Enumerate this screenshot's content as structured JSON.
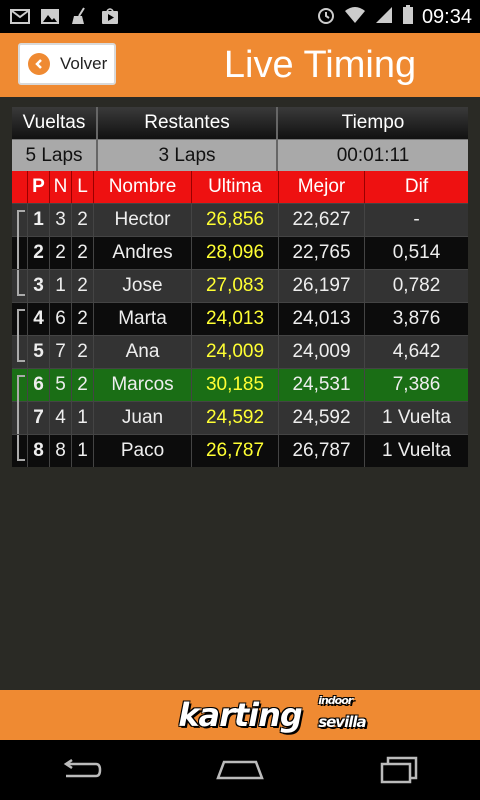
{
  "status": {
    "time": "09:34"
  },
  "header": {
    "back_label": "Volver",
    "title": "Live Timing"
  },
  "summary": {
    "headers": [
      "Vueltas",
      "Restantes",
      "Tiempo"
    ],
    "values": [
      "5 Laps",
      "3 Laps",
      "00:01:11"
    ]
  },
  "columns": {
    "p": "P",
    "n": "N",
    "l": "L",
    "name": "Nombre",
    "last": "Ultima",
    "best": "Mejor",
    "dif": "Dif"
  },
  "rows": [
    {
      "p": "1",
      "n": "3",
      "l": "2",
      "name": "Hector",
      "last": "26,856",
      "best": "22,627",
      "dif": "-"
    },
    {
      "p": "2",
      "n": "2",
      "l": "2",
      "name": "Andres",
      "last": "28,096",
      "best": "22,765",
      "dif": "0,514"
    },
    {
      "p": "3",
      "n": "1",
      "l": "2",
      "name": "Jose",
      "last": "27,083",
      "best": "26,197",
      "dif": "0,782"
    },
    {
      "p": "4",
      "n": "6",
      "l": "2",
      "name": "Marta",
      "last": "24,013",
      "best": "24,013",
      "dif": "3,876"
    },
    {
      "p": "5",
      "n": "7",
      "l": "2",
      "name": "Ana",
      "last": "24,009",
      "best": "24,009",
      "dif": "4,642"
    },
    {
      "p": "6",
      "n": "5",
      "l": "2",
      "name": "Marcos",
      "last": "30,185",
      "best": "24,531",
      "dif": "7,386"
    },
    {
      "p": "7",
      "n": "4",
      "l": "1",
      "name": "Juan",
      "last": "24,592",
      "best": "24,592",
      "dif": "1 Vuelta"
    },
    {
      "p": "8",
      "n": "8",
      "l": "1",
      "name": "Paco",
      "last": "26,787",
      "best": "26,787",
      "dif": "1 Vuelta"
    }
  ],
  "footer": {
    "logo": "karting",
    "logo_sub": "indoor",
    "logo_sub2": "sevilla"
  },
  "colors": {
    "accent": "#ef8a32",
    "header_red": "#ee1111",
    "highlight": "#1a6e15",
    "last_time": "#ffff33"
  }
}
